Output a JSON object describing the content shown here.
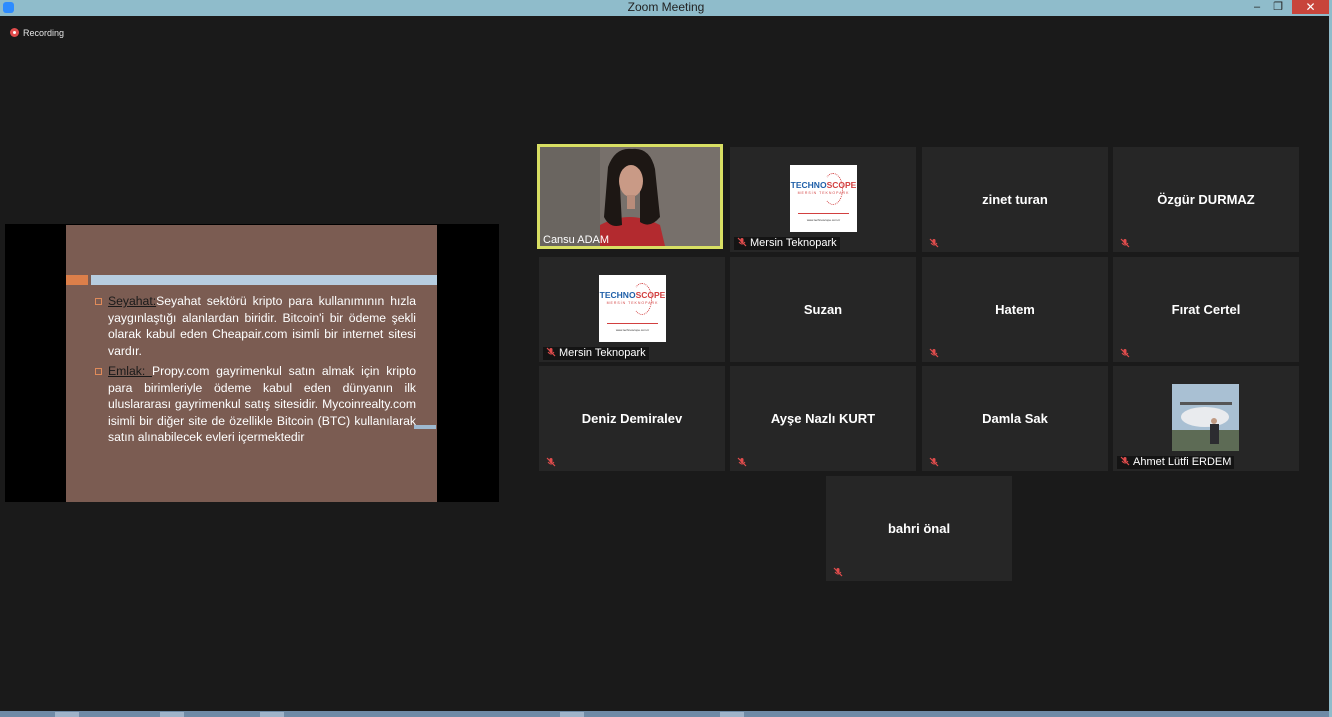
{
  "window": {
    "title": "Zoom Meeting",
    "minimize": "–",
    "restore": "❐",
    "close": "✕"
  },
  "recording": {
    "label": "Recording"
  },
  "slide": {
    "p1_keyword": "Seyahat:",
    "p1_text": "Seyahat sektörü kripto para kullanımının hızla yaygınlaştığı alanlardan biridir. Bitcoin'i bir ödeme şekli olarak kabul eden Cheapair.com isimli bir internet sitesi vardır.",
    "p2_keyword": "Emlak: ",
    "p2_text": "Propy.com gayrimenkul satın almak için kripto para birimleriyle ödeme kabul eden dünyanın ilk uluslararası gayrimenkul satış sitesidir. Mycoinrealty.com isimli bir diğer site de özellikle Bitcoin (BTC) kullanılarak satın alınabilecek evleri içermektedir"
  },
  "logo": {
    "brand_a": "TECHNO",
    "brand_b": "SCOPE",
    "sub": "MERSİN TEKNOPARK",
    "url": "www.technoscope.com.tr"
  },
  "participants": [
    {
      "label": "Cansu ADAM",
      "kind": "video",
      "muted": false,
      "active": true
    },
    {
      "label": "Mersin Teknopark",
      "kind": "logo",
      "muted": true
    },
    {
      "display": "zinet turan",
      "kind": "name",
      "muted": true
    },
    {
      "display": "Özgür DURMAZ",
      "kind": "name",
      "muted": true
    },
    {
      "label": "Mersin Teknopark",
      "kind": "logo",
      "muted": true
    },
    {
      "display": "Suzan",
      "kind": "name",
      "muted": false
    },
    {
      "display": "Hatem",
      "kind": "name",
      "muted": true
    },
    {
      "display": "Fırat Certel",
      "kind": "name",
      "muted": true
    },
    {
      "display": "Deniz Demiralev",
      "kind": "name",
      "muted": true
    },
    {
      "display": "Ayşe Nazlı KURT",
      "kind": "name",
      "muted": true
    },
    {
      "display": "Damla Sak",
      "kind": "name",
      "muted": true
    },
    {
      "label": "Ahmet Lütfi ERDEM",
      "kind": "photo",
      "muted": true
    },
    {
      "display": "bahri önal",
      "kind": "name",
      "muted": true
    }
  ],
  "colors": {
    "accent_active": "#d8df63",
    "muted_icon": "#e04c4c",
    "tile_bg": "#262626",
    "window_bg": "#1a1a1a"
  }
}
